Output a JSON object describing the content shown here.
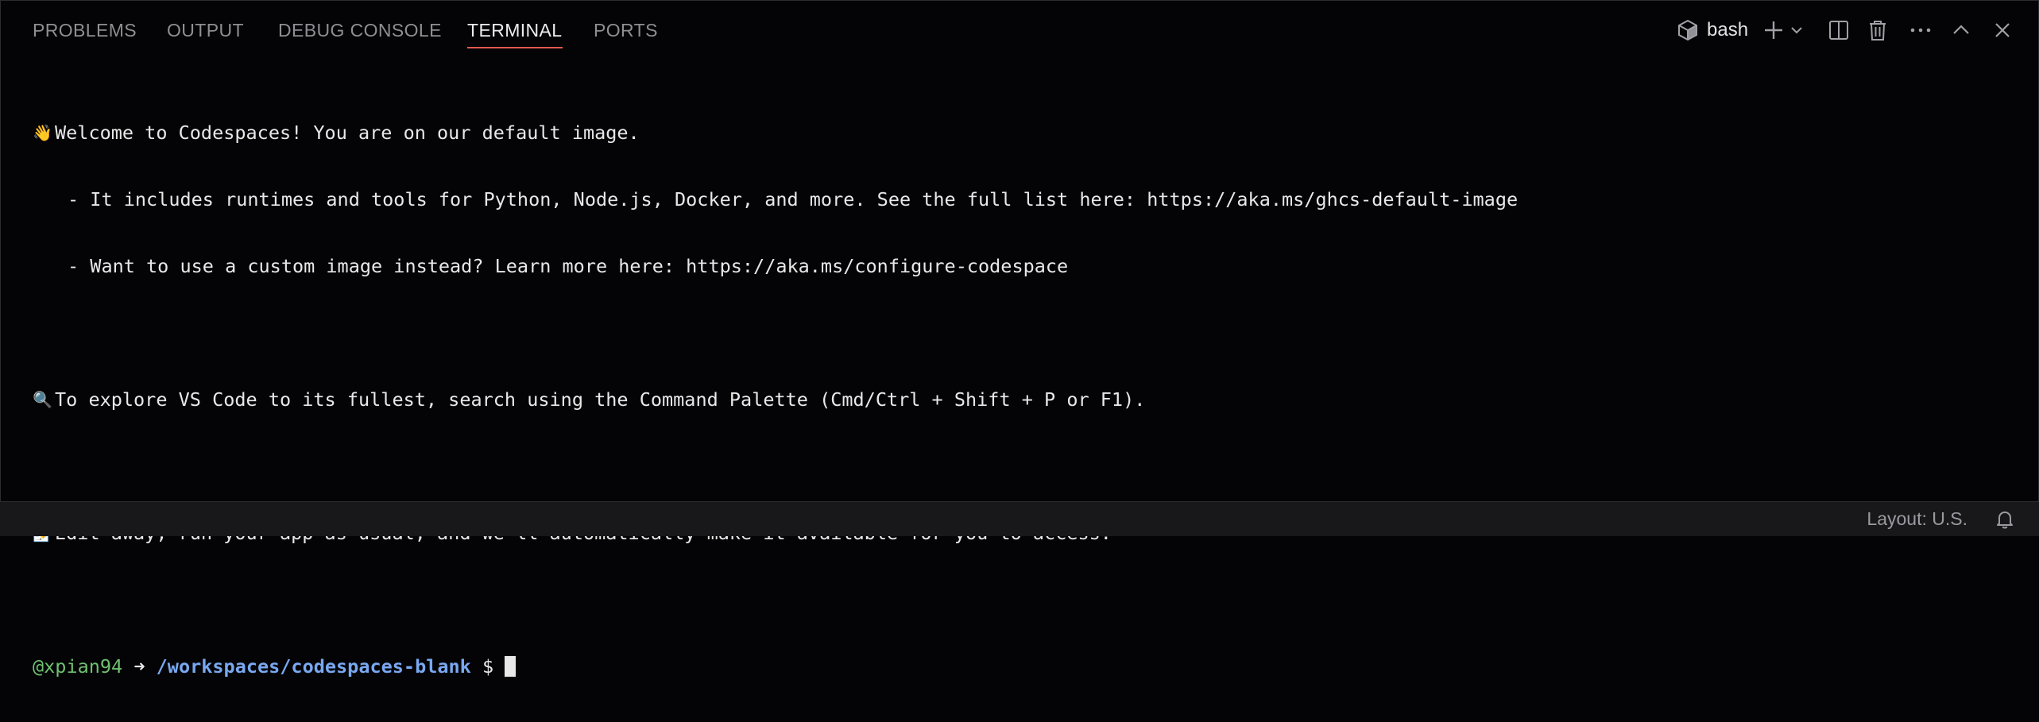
{
  "panel": {
    "tabs": [
      {
        "label": "PROBLEMS"
      },
      {
        "label": "OUTPUT"
      },
      {
        "label": "DEBUG CONSOLE"
      },
      {
        "label": "TERMINAL",
        "active": true
      },
      {
        "label": "PORTS"
      }
    ],
    "shell_name": "bash",
    "actions": [
      "terminal-shell-icon",
      "new-terminal-plus-icon",
      "launch-profile-chevron-icon",
      "split-terminal-icon",
      "kill-terminal-trash-icon",
      "more-actions-ellipsis-icon",
      "maximize-panel-chevron-up-icon",
      "close-panel-icon"
    ]
  },
  "terminal": {
    "welcome_emoji": "👋",
    "welcome": "Welcome to Codespaces! You are on our default image.",
    "bullet1": "- It includes runtimes and tools for Python, Node.js, Docker, and more. See the full list here: https://aka.ms/ghcs-default-image",
    "bullet2": "- Want to use a custom image instead? Learn more here: https://aka.ms/configure-codespace",
    "explore_emoji": "🔍",
    "explore": "To explore VS Code to its fullest, search using the Command Palette (Cmd/Ctrl + Shift + P or F1).",
    "edit_emoji": "📝",
    "edit": "Edit away, run your app as usual, and we'll automatically make it available for you to access.",
    "prompt": {
      "user": "@xpian94",
      "arrow": "➜",
      "path": "/workspaces/codespaces-blank",
      "symbol": "$"
    }
  },
  "statusbar": {
    "layout": "Layout: U.S.",
    "bell_icon": "bell-icon"
  },
  "colors": {
    "background": "#040407",
    "active_tab_underline": "#e2584f",
    "prompt_user": "#6ec16f",
    "prompt_path": "#79a8f0",
    "statusbar_bg": "#18181b"
  }
}
